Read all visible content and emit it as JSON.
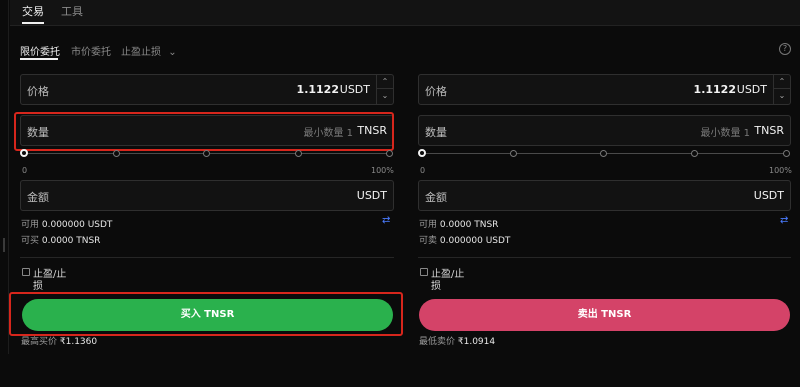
{
  "top_tabs": [
    {
      "label": "交易"
    },
    {
      "label": "工具"
    }
  ],
  "order_tabs": [
    {
      "label": "限价委托"
    },
    {
      "label": "市价委托"
    },
    {
      "label": "止盈止损"
    }
  ],
  "help_glyph": "?",
  "buy": {
    "price_label": "价格",
    "price_value": "1.1122",
    "price_unit": "USDT",
    "qty_label": "数量",
    "qty_placeholder": "最小数量 1",
    "qty_unit": "TNSR",
    "slider_min": "0",
    "slider_max": "100%",
    "slider_value": 0,
    "amount_label": "金额",
    "amount_unit": "USDT",
    "available_label": "可用",
    "available_value": "0.000000 USDT",
    "can_buy_label": "可买",
    "can_buy_value": "0.0000 TNSR",
    "tpsl_line1": "止盈/止",
    "tpsl_line2": "损",
    "button_label": "买入 TNSR",
    "best_price_label": "最高买价",
    "best_price_value": "₹1.1360"
  },
  "sell": {
    "price_label": "价格",
    "price_value": "1.1122",
    "price_unit": "USDT",
    "qty_label": "数量",
    "qty_placeholder": "最小数量 1",
    "qty_unit": "TNSR",
    "slider_min": "0",
    "slider_max": "100%",
    "slider_value": 0,
    "amount_label": "金额",
    "amount_unit": "USDT",
    "available_label": "可用",
    "available_value": "0.0000 TNSR",
    "can_buy_label": "可卖",
    "can_buy_value": "0.000000 USDT",
    "tpsl_line1": "止盈/止",
    "tpsl_line2": "损",
    "button_label": "卖出 TNSR",
    "best_price_label": "最低卖价",
    "best_price_value": "₹1.0914"
  },
  "colors": {
    "buy": "#2ab14d",
    "sell": "#d44368",
    "highlight": "#d7261c",
    "swap": "#4a7bff"
  },
  "icons": {
    "step_up": "⌃",
    "step_down": "⌄",
    "swap": "⇄",
    "chevron_down": "⌄"
  }
}
